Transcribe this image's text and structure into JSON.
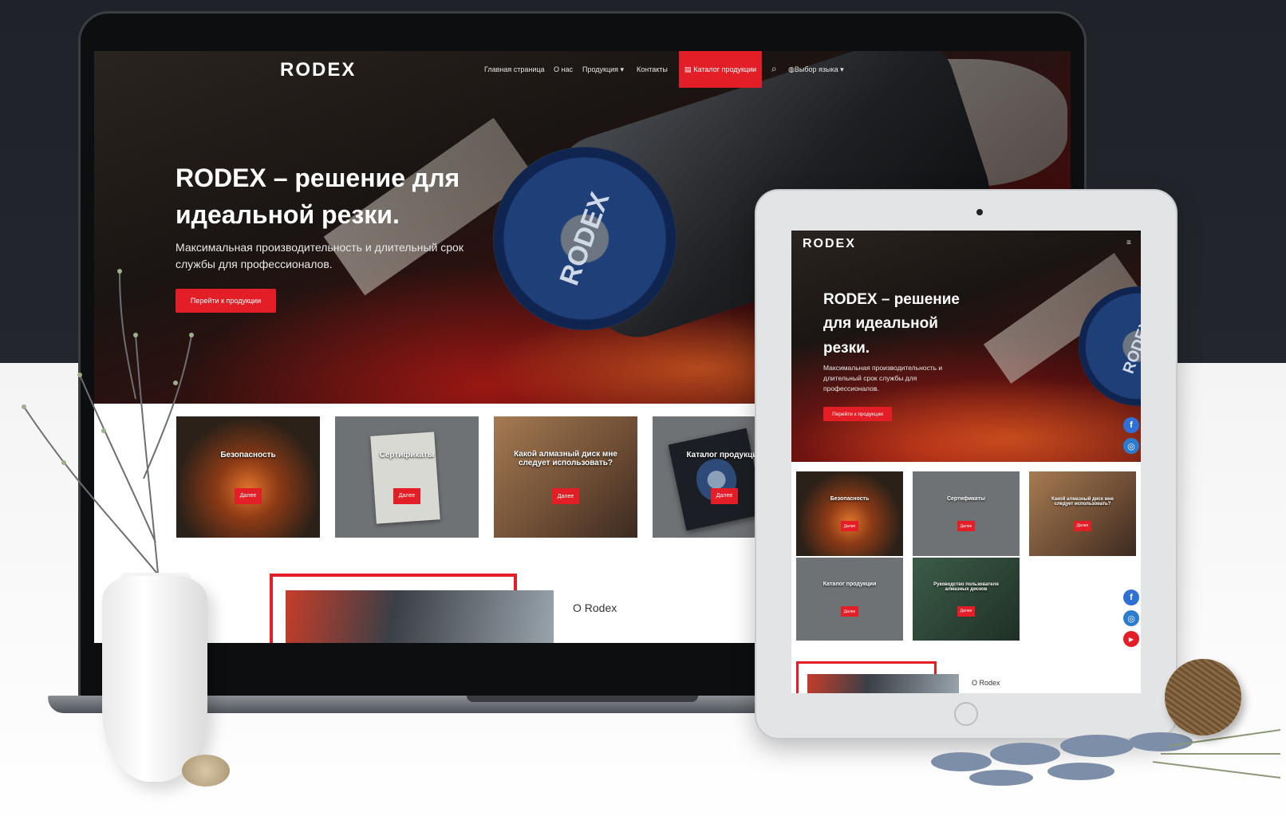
{
  "brand": {
    "logo": "RODEX",
    "accent": "#e41e26"
  },
  "nav": {
    "home": "Главная страница",
    "about": "О нас",
    "products": "Продукция",
    "contacts": "Контакты",
    "catalog": "Каталог продукции",
    "language": "Выбор языка"
  },
  "hero": {
    "title_line1": "RODEX – решение для",
    "title_line2": "идеальной резки.",
    "subtitle_line1": "Максимальная производительность и длительный срок",
    "subtitle_line2": "службы для профессионалов.",
    "cta": "Перейти к продукции",
    "disc_brand": "RODEX"
  },
  "cards": [
    {
      "title": "Безопасность",
      "button": "Далее"
    },
    {
      "title": "Сертификаты",
      "button": "Далее"
    },
    {
      "title": "Какой алмазный диск мне следует использовать?",
      "button": "Далее"
    },
    {
      "title": "Каталог продукции",
      "button": "Далее"
    },
    {
      "title": "Руководство пользователя алмазных дисков",
      "button": "Далее"
    }
  ],
  "about": {
    "heading": "О Rodex"
  },
  "tablet_hero": {
    "title_line1": "RODEX – решение",
    "title_line2": "для идеальной",
    "title_line3": "резки.",
    "subtitle_line1": "Максимальная производительность и",
    "subtitle_line2": "длительный срок службы для",
    "subtitle_line3": "профессионалов."
  },
  "social": {
    "facebook": "f",
    "instagram": "◎",
    "youtube": "▶"
  },
  "colors": {
    "facebook": "#2f6fd6",
    "instagram": "#2b7bd1",
    "youtube": "#e41e26",
    "dark_bg": "#23272d"
  }
}
